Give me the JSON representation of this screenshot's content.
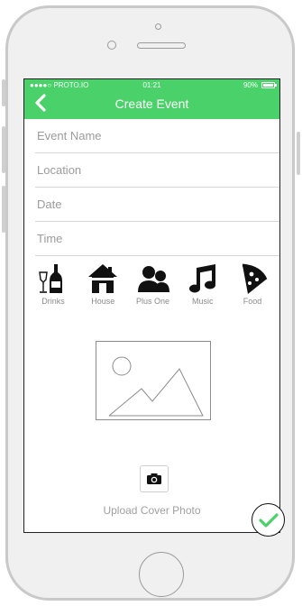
{
  "status_bar": {
    "carrier": "●●●●○ PROTO.IO",
    "time": "01:21",
    "battery": "90%"
  },
  "header": {
    "title": "Create Event",
    "back_icon": "chevron-left-icon"
  },
  "form": {
    "fields": [
      {
        "placeholder": "Event Name"
      },
      {
        "placeholder": "Location"
      },
      {
        "placeholder": "Date"
      },
      {
        "placeholder": "Time"
      }
    ]
  },
  "categories": [
    {
      "label": "Drinks",
      "icon": "drinks-icon"
    },
    {
      "label": "House",
      "icon": "house-icon"
    },
    {
      "label": "Plus One",
      "icon": "people-icon"
    },
    {
      "label": "Music",
      "icon": "music-note-icon"
    },
    {
      "label": "Food",
      "icon": "pizza-icon"
    }
  ],
  "cover": {
    "upload_label": "Upload Cover Photo",
    "camera_icon": "camera-icon",
    "placeholder_icon": "image-placeholder-icon"
  },
  "confirm": {
    "icon": "checkmark-icon",
    "color": "#4bd16a"
  },
  "colors": {
    "accent": "#4bd16a",
    "frame": "#f0f0f0"
  }
}
